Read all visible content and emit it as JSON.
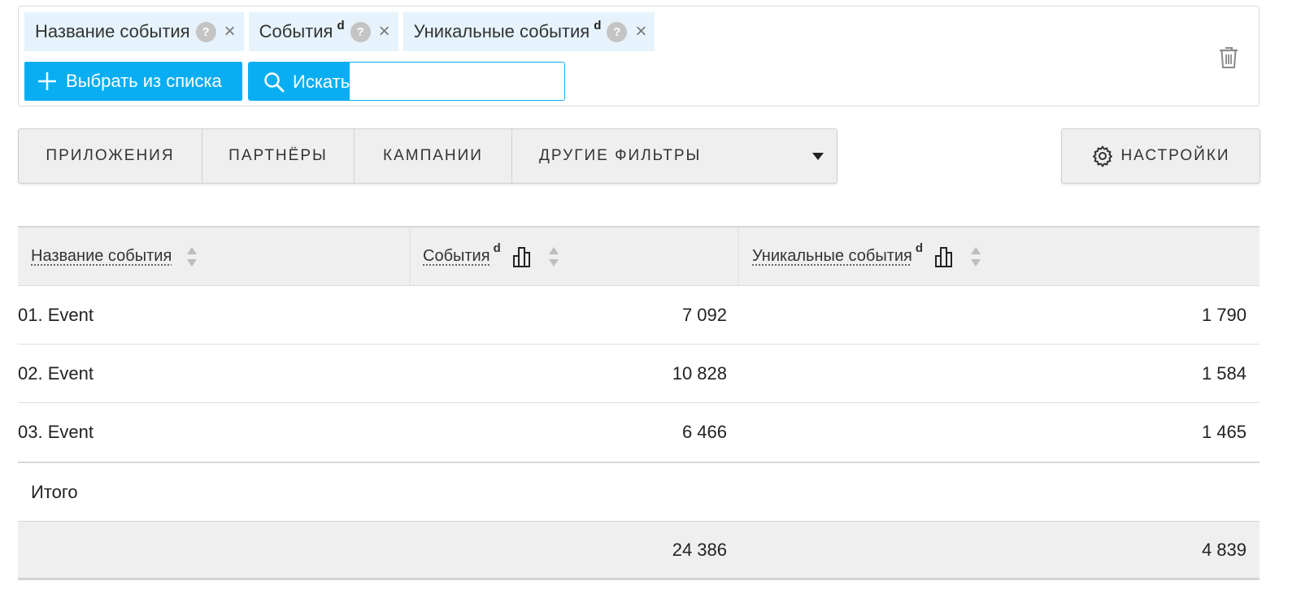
{
  "metrics": {
    "chips": [
      {
        "label": "Название события",
        "sup": "",
        "help": "?",
        "close": "×"
      },
      {
        "label": "События",
        "sup": "d",
        "help": "?",
        "close": "×"
      },
      {
        "label": "Уникальные события",
        "sup": "d",
        "help": "?",
        "close": "×"
      }
    ],
    "pick_label": "Выбрать из списка",
    "search_label": "Искать",
    "search_value": "",
    "trash_icon": "trash-icon"
  },
  "filters": {
    "apps": "ПРИЛОЖЕНИЯ",
    "partners": "ПАРТНЁРЫ",
    "campaigns": "КАМПАНИИ",
    "other": "ДРУГИЕ ФИЛЬТРЫ",
    "settings": "НАСТРОЙКИ"
  },
  "table": {
    "headers": {
      "name": "Название события",
      "events": "События",
      "events_sup": "d",
      "unique": "Уникальные события",
      "unique_sup": "d"
    },
    "rows": [
      {
        "name": "01. Event",
        "events": "7 092",
        "unique": "1 790"
      },
      {
        "name": "02. Event",
        "events": "10 828",
        "unique": "1 584"
      },
      {
        "name": "03. Event",
        "events": "6 466",
        "unique": "1 465"
      }
    ],
    "total_label": "Итого",
    "total": {
      "events": "24 386",
      "unique": "4 839"
    }
  },
  "colors": {
    "accent": "#09aef2",
    "chip_bg": "#e6f3fc",
    "header_bg": "#efefef"
  }
}
